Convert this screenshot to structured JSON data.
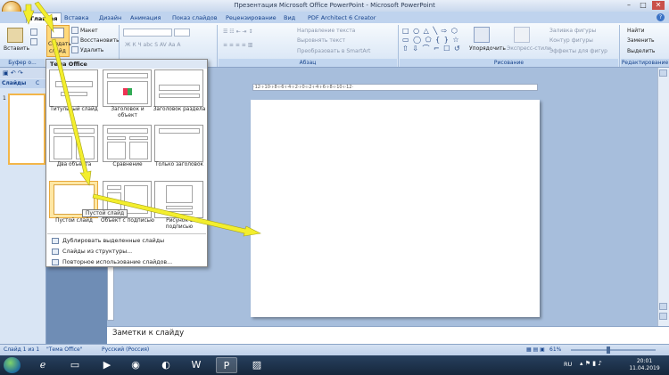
{
  "window": {
    "title": "Презентация Microsoft Office PowerPoint - Microsoft PowerPoint",
    "controls": [
      "–",
      "□",
      "✕"
    ]
  },
  "tabs": [
    "Главная",
    "Вставка",
    "Дизайн",
    "Анимация",
    "Показ слайдов",
    "Рецензирование",
    "Вид",
    "PDF Architect 6 Creator"
  ],
  "active_tab": "Главная",
  "ribbon": {
    "paste": "Вставить",
    "new_slide": [
      "Создать",
      "слайд"
    ],
    "layout": "Макет",
    "restore": "Восстановить",
    "delete": "Удалить",
    "clipboard_group": "Буфер о...",
    "paragraph_group": "Абзац",
    "text_direction": "Направление текста",
    "align_text": "Выровнять текст",
    "smartart": "Преобразовать в SmartArt",
    "arrange": "Упорядочить",
    "quick_styles": "Экспресс-стили",
    "shape_fill": "Заливка фигуры",
    "shape_outline": "Контур фигуры",
    "shape_effects": "Эффекты для фигур",
    "drawing_group": "Рисование",
    "find": "Найти",
    "replace": "Заменить",
    "select": "Выделить",
    "editing_group": "Редактирование"
  },
  "sidebar": {
    "tab_slides": "Слайды",
    "tab_structure": "С",
    "slide_number": "1"
  },
  "gallery": {
    "header": "Тема Office",
    "layouts": [
      {
        "label": "Титульный слайд"
      },
      {
        "label": "Заголовок и объект"
      },
      {
        "label": "Заголовок раздела"
      },
      {
        "label": "Два объекта"
      },
      {
        "label": "Сравнение"
      },
      {
        "label": "Только заголовок"
      },
      {
        "label": "Пустой слайд"
      },
      {
        "label": "Объект с подписью"
      },
      {
        "label": "Рисунок с подписью"
      }
    ],
    "tooltip": "Пустой слайд",
    "menu": [
      "Дублировать выделенные слайды",
      "Слайды из структуры...",
      "Повторное использование слайдов..."
    ]
  },
  "ruler": {
    "text": "·12·ı·10·ı·8·ı·6·ı·4·ı·2·ı·0·ı·2·ı·4·ı·6·ı·8·ı·10·ı·12·"
  },
  "notes": {
    "placeholder": "Заметки к слайду"
  },
  "status": {
    "slide": "Слайд 1 из 1",
    "theme": "\"Тема Office\"",
    "language": "Русский (Россия)",
    "zoom": "61%"
  },
  "taskbar": {
    "lang": "RU",
    "time": "20:01",
    "date": "11.04.2019"
  },
  "colors": {
    "ribbon": "#d6e4f5",
    "canvas": "#a7bedc",
    "highlight": "#ffe7a4",
    "arrow": "#f3ee2d"
  }
}
